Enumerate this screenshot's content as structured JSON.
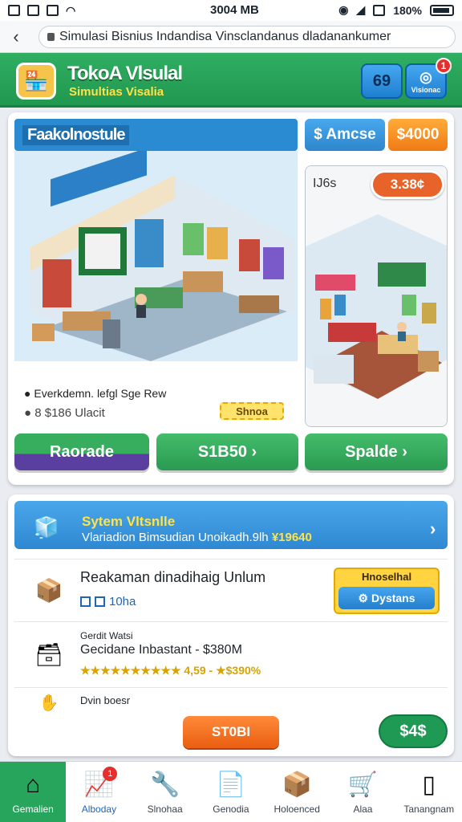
{
  "status": {
    "time": "3004 MB",
    "battery": "180%"
  },
  "browser": {
    "url": "Simulasi Bisnius Indandisa Vinsclandanus dladanankumer"
  },
  "header": {
    "title": "TokoA Vlsulal",
    "subtitle": "Simultias Visalia",
    "button_one": "69",
    "button_two": "Visionac",
    "notification_count": "1",
    "accent_color": "#2fae62"
  },
  "store": {
    "title": "Faakolnostule",
    "pill_blue": "$ Amcse",
    "pill_orange": "$4000",
    "secondary_label": "IJ6s",
    "secondary_price": "3.38¢",
    "info_line1": "Everkdemn. lefgl Sge Rew",
    "info_line2": "8 $186 Ulacit",
    "mini_button": "Shnoa",
    "actions": [
      {
        "label": "Raorade"
      },
      {
        "label": "S1B50 ›"
      },
      {
        "label": "Spalde ›"
      }
    ]
  },
  "system": {
    "title": "Sytem Vltsnlle",
    "subtitle": "Vlariadion Bimsudian Unoikadh.9lh",
    "subtitle_value": "¥19640",
    "rows": [
      {
        "title": "Reakaman dinadihaig Unlum",
        "sub": "10ha",
        "box_label": "Hnoselhal",
        "box_button": "Dystans"
      },
      {
        "title": "Gerdit Watsi",
        "sub": "Gecidane Inbastant - $380M",
        "stars": "★★★★★★★★★★ 4,59 - ★$390%"
      },
      {
        "title": "Dvin boesr"
      }
    ]
  },
  "footer": {
    "stock_button": "ST0BI",
    "money": "$4$"
  },
  "nav": {
    "items": [
      {
        "label": "Gemalien",
        "icon": "home-icon"
      },
      {
        "label": "Alboday",
        "icon": "chart-icon",
        "badge": "1"
      },
      {
        "label": "Slnohaa",
        "icon": "tools-icon"
      },
      {
        "label": "Genodia",
        "icon": "document-icon"
      },
      {
        "label": "Holoenced",
        "icon": "box-icon"
      },
      {
        "label": "Alaa",
        "icon": "cart-icon"
      },
      {
        "label": "Tanangnam",
        "icon": "stock-icon"
      }
    ]
  }
}
